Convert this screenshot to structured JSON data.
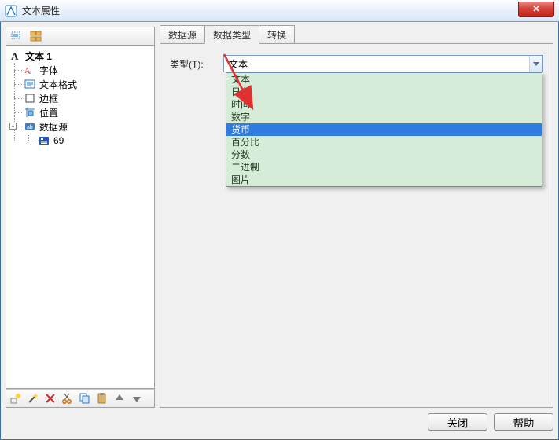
{
  "window": {
    "title": "文本属性"
  },
  "tree": {
    "root_label": "文本 1",
    "items": [
      {
        "label": "字体"
      },
      {
        "label": "文本格式"
      },
      {
        "label": "边框"
      },
      {
        "label": "位置"
      },
      {
        "label": "数据源",
        "child": {
          "label": "69"
        }
      }
    ]
  },
  "tabs": [
    {
      "label": "数据源"
    },
    {
      "label": "数据类型"
    },
    {
      "label": "转换"
    }
  ],
  "active_tab": 1,
  "form": {
    "type_label": "类型(T):",
    "type_value": "文本"
  },
  "dropdown_options": [
    "文本",
    "日期",
    "时间",
    "数字",
    "货币",
    "百分比",
    "分数",
    "二进制",
    "图片"
  ],
  "dropdown_highlight_index": 4,
  "footer": {
    "close": "关闭",
    "help": "帮助"
  }
}
